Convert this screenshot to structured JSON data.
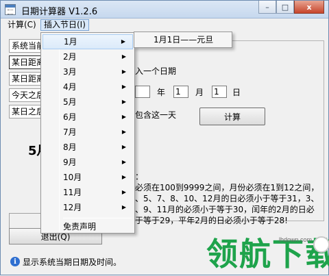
{
  "window": {
    "title": "日期计算器  V1.2.6",
    "buttons": {
      "minimize": "–",
      "maximize": "□",
      "close": "x"
    }
  },
  "menubar": {
    "items": [
      "计算(C)",
      "插入节日(I)"
    ]
  },
  "sidebar": {
    "tabs": [
      "系统当前",
      "某日距离",
      "某日距离",
      "今天之后",
      "某日之后"
    ]
  },
  "main": {
    "prompt": "入一个日期",
    "year_value": "",
    "year_label": "年",
    "month_value": "1",
    "month_label": "月",
    "day_value": "1",
    "day_label": "日",
    "include_label": "包含这一天",
    "calc_button": "计算",
    "result_big": "5月",
    "notes_title": "：",
    "notes_lines": [
      "必须在100到9999之间，月份必须在1到12之间，",
      "、5、7、8、10、12月的日必须小于等于31，3、",
      "、9、11月的必须小于等于30，闰年的2月的日必",
      "于等于29，平年2月的日必须小于等于28!"
    ],
    "exit_button": "退出(Q)"
  },
  "dropdown": {
    "items": [
      {
        "label": "1月",
        "has_submenu": true
      },
      {
        "label": "2月",
        "has_submenu": true
      },
      {
        "label": "3月",
        "has_submenu": true
      },
      {
        "label": "4月",
        "has_submenu": true
      },
      {
        "label": "5月",
        "has_submenu": true
      },
      {
        "label": "6月",
        "has_submenu": true
      },
      {
        "label": "7月",
        "has_submenu": true
      },
      {
        "label": "8月",
        "has_submenu": true
      },
      {
        "label": "9月",
        "has_submenu": true
      },
      {
        "label": "10月",
        "has_submenu": true
      },
      {
        "label": "11月",
        "has_submenu": true
      },
      {
        "label": "12月",
        "has_submenu": true
      }
    ],
    "last_item": "免责声明",
    "arrow": "▶"
  },
  "submenu": {
    "item": "1月1日——元旦"
  },
  "status": {
    "icon": "info-icon",
    "text": "显示系统当期日期及时间。"
  },
  "watermark": {
    "site": "lhdown.com",
    "text": "领航下载"
  },
  "colors": {
    "accent": "#d9e8f8",
    "watermark_green": "#1ea34b",
    "info_blue": "#2f6fd0"
  }
}
